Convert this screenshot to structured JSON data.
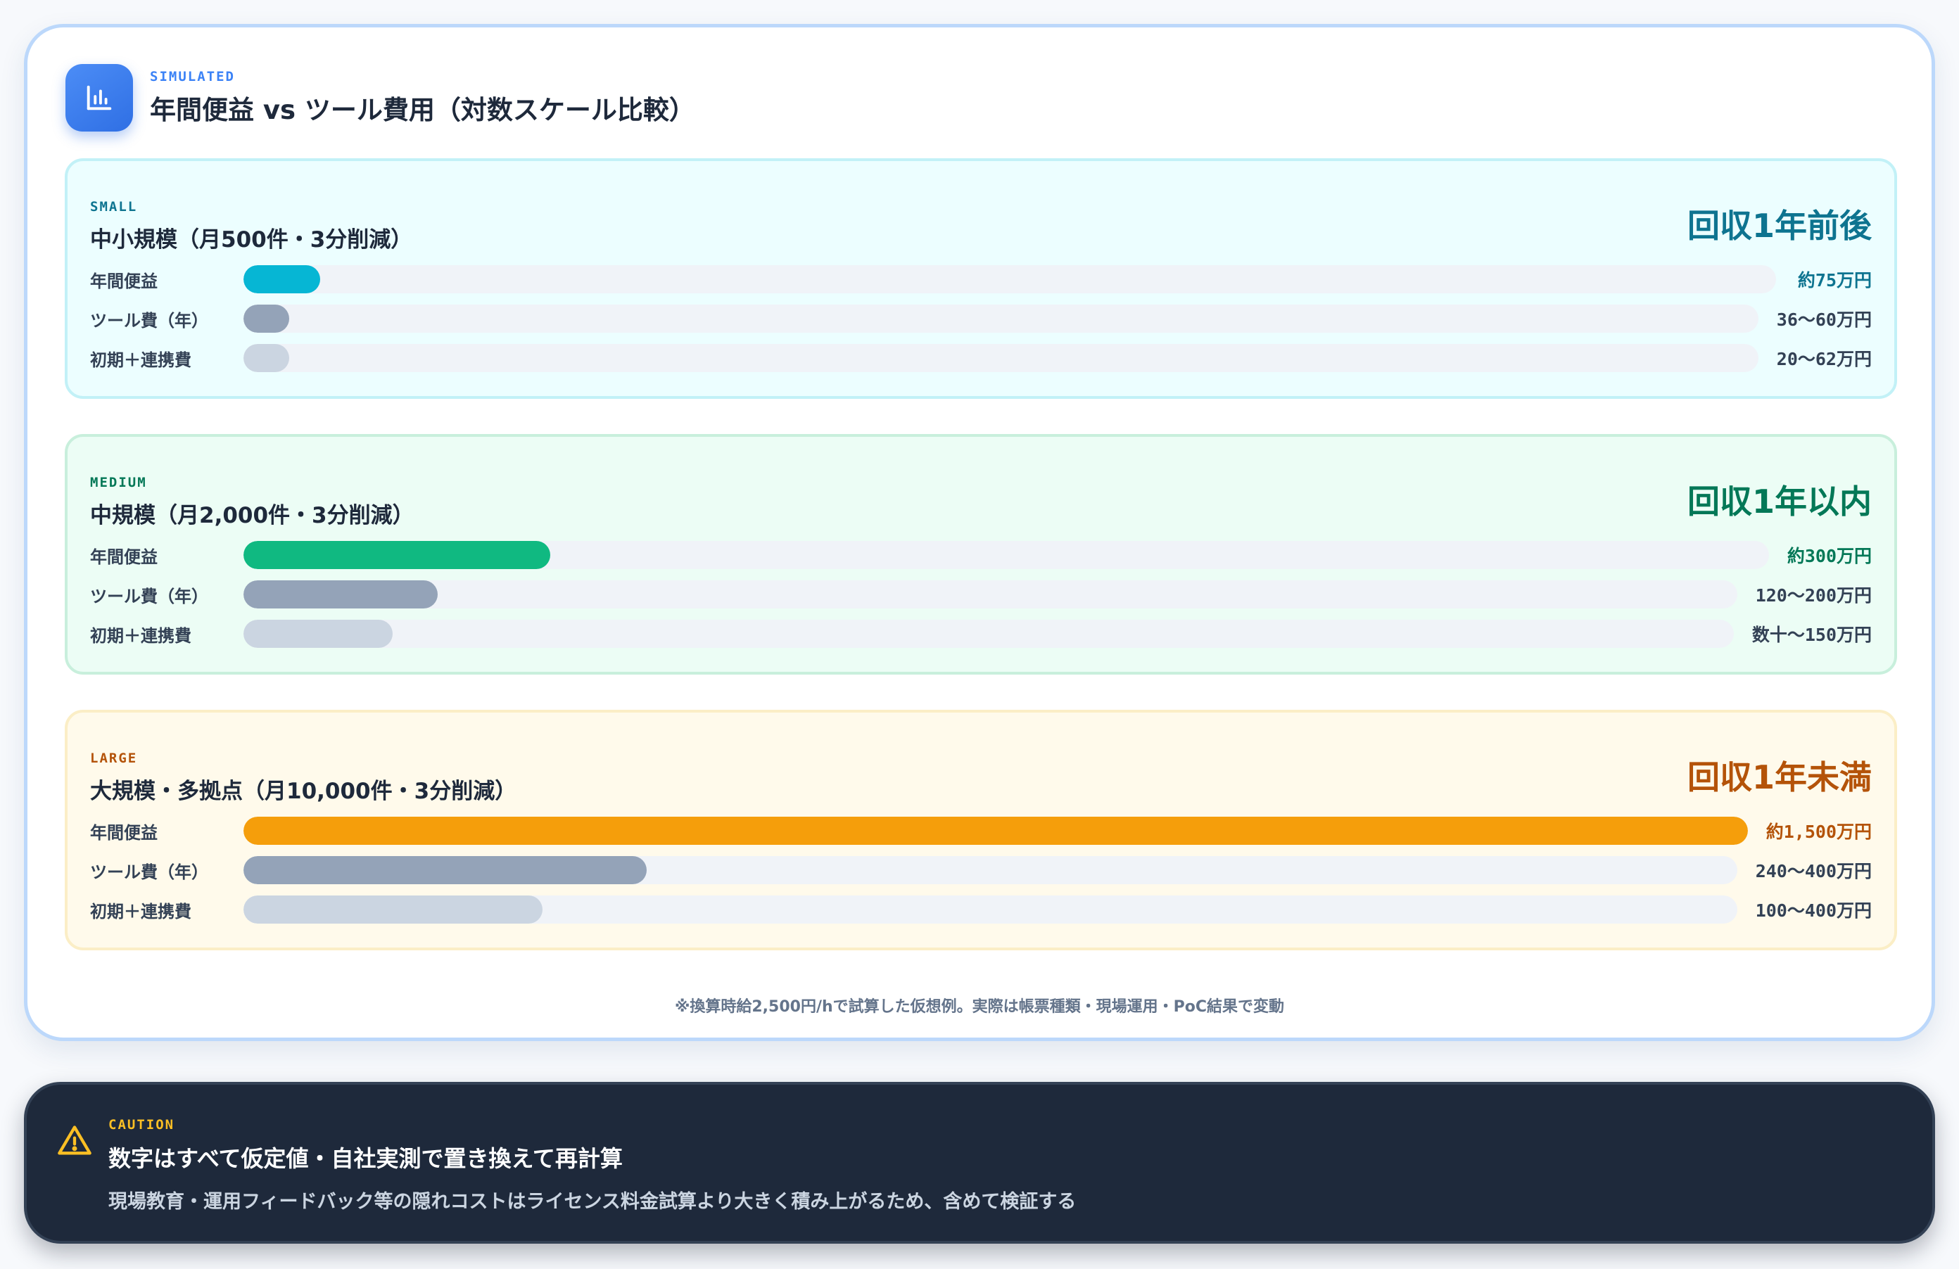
{
  "header": {
    "eyebrow": "SIMULATED",
    "title": "年間便益 vs ツール費用（対数スケール比較）",
    "icon": "bar-chart-icon",
    "accent_color": "#3b82f6"
  },
  "scenarios": [
    {
      "eyebrow": "SMALL",
      "title": "中小規模（月500件・3分削減）",
      "payback": "回収1年前後",
      "accent_color": "#0e7490",
      "bars": [
        {
          "label": "年間便益",
          "value": "約75万円",
          "fill_fraction": 0.05
        },
        {
          "label": "ツール費（年）",
          "value": "36〜60万円",
          "fill_fraction": 0.03
        },
        {
          "label": "初期＋連携費",
          "value": "20〜62万円",
          "fill_fraction": 0.03
        }
      ]
    },
    {
      "eyebrow": "MEDIUM",
      "title": "中規模（月2,000件・3分削減）",
      "payback": "回収1年以内",
      "accent_color": "#047857",
      "bars": [
        {
          "label": "年間便益",
          "value": "約300万円",
          "fill_fraction": 0.201
        },
        {
          "label": "ツール費（年）",
          "value": "120〜200万円",
          "fill_fraction": 0.13
        },
        {
          "label": "初期＋連携費",
          "value": "数十〜150万円",
          "fill_fraction": 0.1
        }
      ]
    },
    {
      "eyebrow": "LARGE",
      "title": "大規模・多拠点（月10,000件・3分削減）",
      "payback": "回収1年未満",
      "accent_color": "#b45309",
      "bars": [
        {
          "label": "年間便益",
          "value": "約1,500万円",
          "fill_fraction": 1.0
        },
        {
          "label": "ツール費（年）",
          "value": "240〜400万円",
          "fill_fraction": 0.27
        },
        {
          "label": "初期＋連携費",
          "value": "100〜400万円",
          "fill_fraction": 0.2
        }
      ]
    }
  ],
  "footnote": "※換算時給2,500円/hで試算した仮想例。実際は帳票種類・現場運用・PoC結果で変動",
  "caution": {
    "eyebrow": "CAUTION",
    "title": "数字はすべて仮定値・自社実測で置き換えて再計算",
    "description": "現場教育・運用フィードバック等の隠れコストはライセンス料金試算より大きく積み上がるため、含めて検証する",
    "icon": "warning-triangle-icon",
    "accent_color": "#fbbf24"
  }
}
